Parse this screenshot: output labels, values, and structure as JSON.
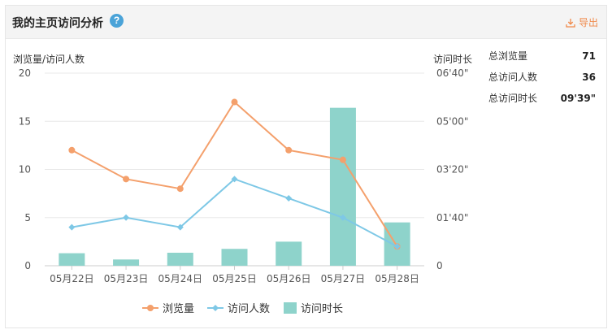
{
  "header": {
    "title": "我的主页访问分析",
    "help_glyph": "?",
    "export_label": "导出"
  },
  "summary": [
    {
      "label": "总浏览量",
      "value": "71"
    },
    {
      "label": "总访问人数",
      "value": "36"
    },
    {
      "label": "总访问时长",
      "value": "09'39\""
    }
  ],
  "colors": {
    "views": "#f4a06c",
    "visitors": "#7ec8e6",
    "duration": "#8ed3cb",
    "accent": "#f08a4b"
  },
  "chart_data": {
    "type": "bar+line",
    "categories": [
      "05月22日",
      "05月23日",
      "05月24日",
      "05月25日",
      "05月26日",
      "05月27日",
      "05月28日"
    ],
    "y_left": {
      "label": "浏览量/访问人数",
      "ticks": [
        "0",
        "5",
        "10",
        "15",
        "20"
      ],
      "range": [
        0,
        20
      ]
    },
    "y_right": {
      "label": "访问时长",
      "ticks": [
        "0",
        "01'40\"",
        "03'20\"",
        "05'00\"",
        "06'40\""
      ],
      "range_seconds": [
        0,
        400
      ]
    },
    "series": [
      {
        "name": "浏览量",
        "type": "line",
        "axis": "left",
        "values": [
          12,
          9,
          8,
          17,
          12,
          11,
          2
        ]
      },
      {
        "name": "访问人数",
        "type": "line",
        "axis": "left",
        "values": [
          4,
          5,
          4,
          9,
          7,
          5,
          2
        ]
      },
      {
        "name": "访问时长",
        "type": "bar",
        "axis": "right",
        "values_seconds": [
          26,
          13,
          27,
          35,
          50,
          328,
          90
        ]
      }
    ],
    "grid": true,
    "legend_position": "bottom"
  }
}
